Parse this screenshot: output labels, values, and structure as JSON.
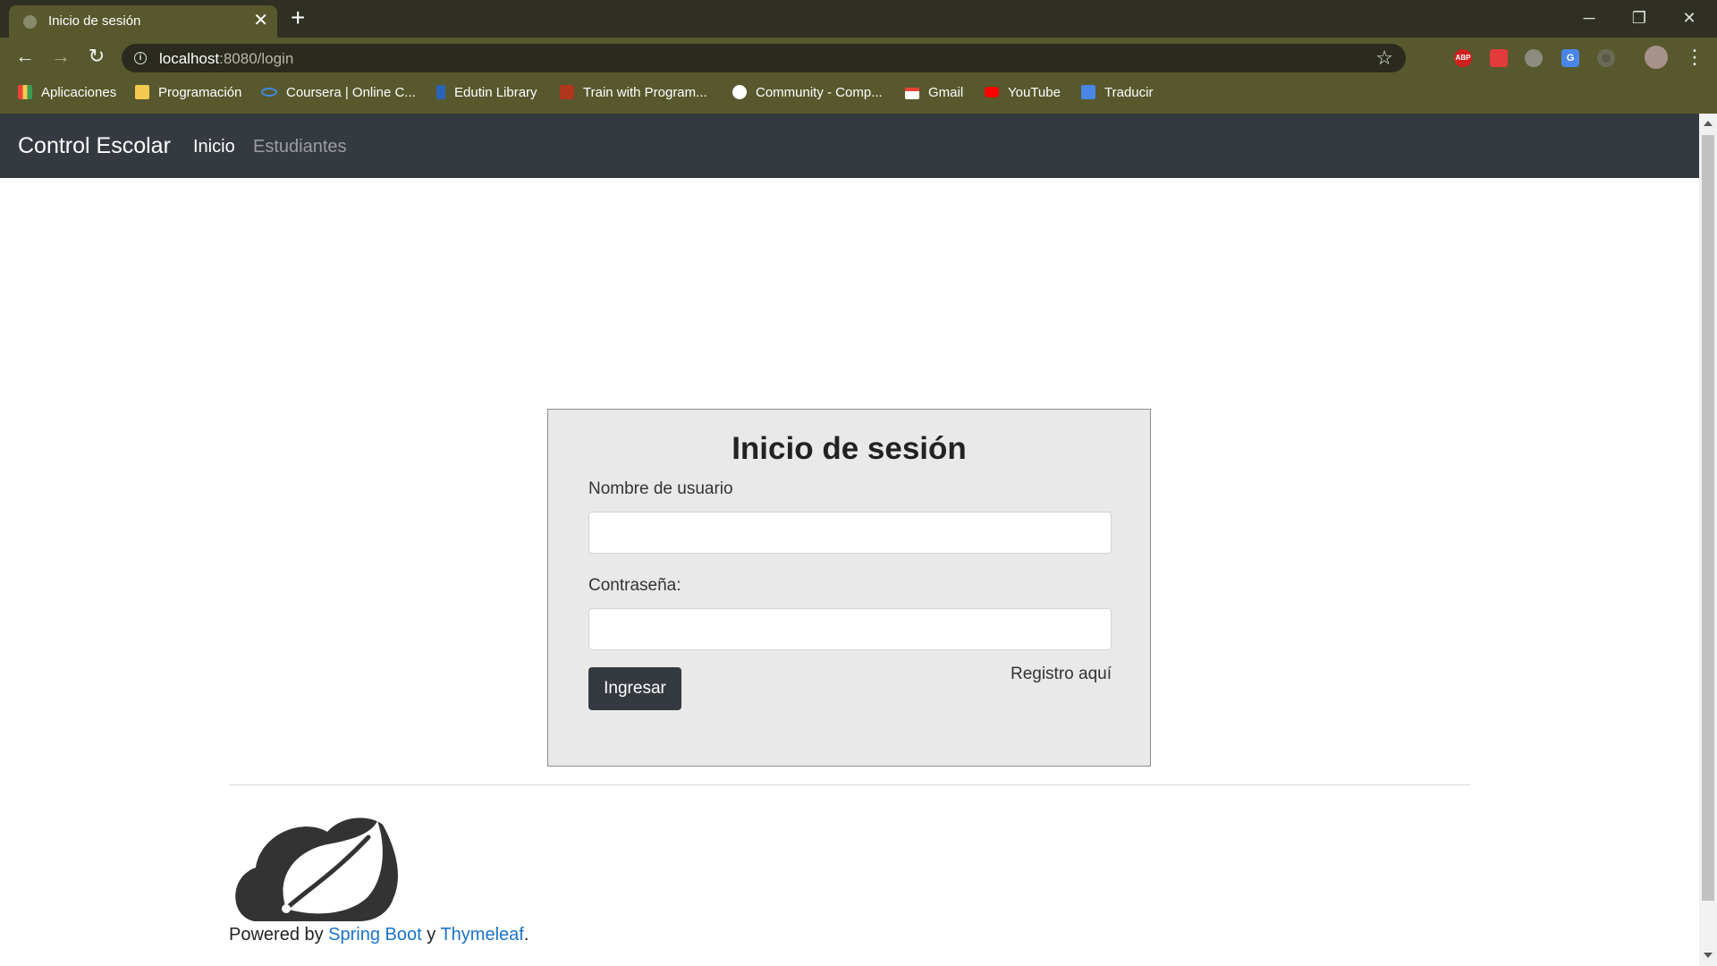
{
  "browser": {
    "tab_title": "Inicio de sesión",
    "url_host": "localhost",
    "url_path": ":8080/login",
    "new_tab_label": "+",
    "close_tab_label": "✕",
    "minimize_label": "─",
    "restore_label": "❐",
    "close_window_label": "✕",
    "back_label": "←",
    "forward_label": "→",
    "reload_label": "↻",
    "star_label": "☆",
    "info_label": "i",
    "menu_label": "⋮",
    "extensions": [
      {
        "name": "adblock-plus-icon",
        "label": "ABP"
      },
      {
        "name": "pocket-icon",
        "label": ""
      },
      {
        "name": "globe-extension-icon",
        "label": ""
      },
      {
        "name": "google-translate-icon",
        "label": "G"
      },
      {
        "name": "record-extension-icon",
        "label": ""
      }
    ]
  },
  "bookmarks": [
    {
      "label": "Aplicaciones",
      "icon": "apps-grid-icon",
      "color": "#e8453c"
    },
    {
      "label": "Programación",
      "icon": "folder-icon",
      "color": "#f4c94f"
    },
    {
      "label": "Coursera | Online C...",
      "icon": "coursera-icon",
      "color": "#3f8de3"
    },
    {
      "label": "Edutin Library",
      "icon": "edutin-icon",
      "color": "#2b63b8"
    },
    {
      "label": "Train with Program...",
      "icon": "codewars-icon",
      "color": "#b1361e"
    },
    {
      "label": "Community - Comp...",
      "icon": "globe-icon",
      "color": "#ffffff"
    },
    {
      "label": "Gmail",
      "icon": "gmail-icon",
      "color": "#ea4335"
    },
    {
      "label": "YouTube",
      "icon": "youtube-icon",
      "color": "#ff0000"
    },
    {
      "label": "Traducir",
      "icon": "translate-icon",
      "color": "#4a86e8"
    }
  ],
  "navbar": {
    "brand": "Control Escolar",
    "links": [
      "Inicio",
      "Estudiantes"
    ]
  },
  "login": {
    "title": "Inicio de sesión",
    "username_label": "Nombre de usuario",
    "username_value": "",
    "password_label": "Contraseña:",
    "password_value": "",
    "submit_label": "Ingresar",
    "register_label": "Registro aquí"
  },
  "footer": {
    "powered_prefix": "Powered by ",
    "spring_boot": "Spring Boot",
    "connector": " y ",
    "thymeleaf": "Thymeleaf",
    "suffix": "."
  },
  "colors": {
    "navbar_bg": "#343a40",
    "card_bg": "#e9e9e9",
    "link": "#1a73c8",
    "chrome_toolbar": "#58582e"
  }
}
